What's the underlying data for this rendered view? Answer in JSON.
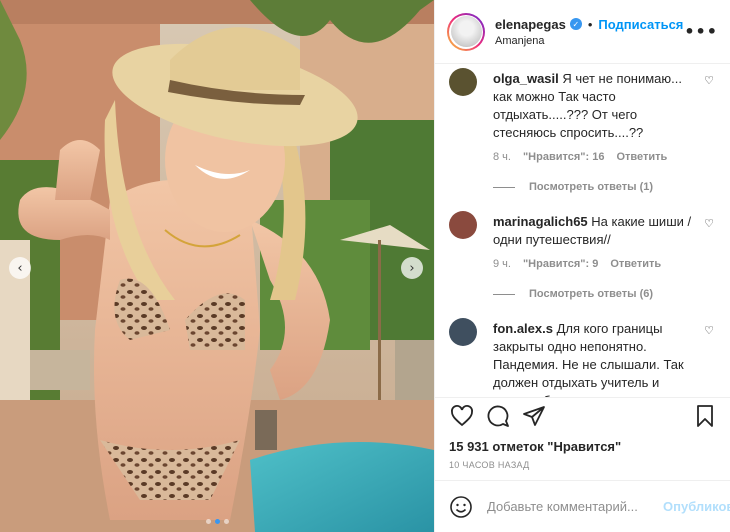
{
  "header": {
    "username": "elenapegas",
    "separator": "•",
    "follow_label": "Подписаться",
    "location": "Amanjena",
    "more_label": "•••",
    "verified_glyph": "✓"
  },
  "comments": [
    {
      "user": "olga_wasil",
      "text": "Я чет не понимаю... как можно Так часто отдыхать.....??? От чего стесняюсь спросить....??",
      "age": "8 ч.",
      "likes": "\"Нравится\": 16",
      "reply_label": "Ответить",
      "view_replies": "Посмотреть ответы (1)",
      "avatar_color": "#5a5230"
    },
    {
      "user": "marinagalich65",
      "text": "На какие шиши / одни путешествия//",
      "age": "9 ч.",
      "likes": "\"Нравится\": 9",
      "reply_label": "Ответить",
      "view_replies": "Посмотреть ответы (6)",
      "avatar_color": "#8a4a3e"
    },
    {
      "user": "fon.alex.s",
      "text": "Для кого границы закрыты одно непонятно. Пандемия. Не не слышали. Так должен отдыхать учитель и хирург областного госпиталя вот",
      "avatar_color": "#3f4f5f"
    }
  ],
  "icons": {
    "heart": "heart-icon",
    "comment": "comment-icon",
    "share": "share-icon",
    "save": "bookmark-icon",
    "emoji": "emoji-icon"
  },
  "post": {
    "likes_text": "15 931 отметок \"Нравится\"",
    "time_text": "10 ЧАСОВ НАЗАД"
  },
  "add_comment": {
    "placeholder": "Добавьте комментарий...",
    "publish_label": "Опубликовать"
  },
  "carousel": {
    "prev_glyph": "‹",
    "next_glyph": "›",
    "dot_count": 3,
    "active_index": 1
  },
  "colors": {
    "accent": "#0095f6",
    "publish_disabled": "#b2dffc",
    "meta": "#8e8e8e"
  }
}
